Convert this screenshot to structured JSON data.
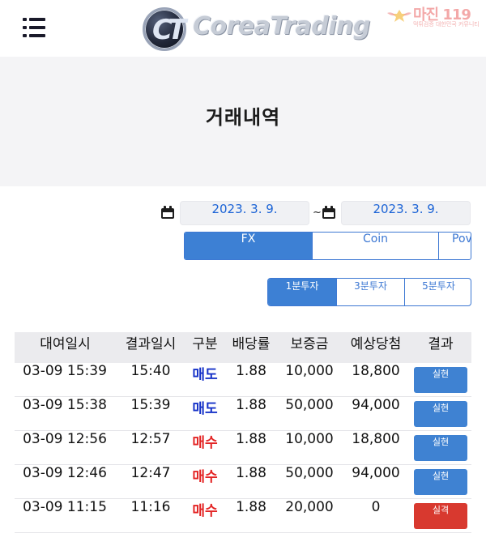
{
  "header": {
    "logo_text": "CoreaTrading",
    "logo_glyph": "CT",
    "watermark_title": "마진 119",
    "watermark_sub": "먹튀검증 대한민국 커뮤니티"
  },
  "page": {
    "title": "거래내역"
  },
  "filters": {
    "date_from": "2023. 3. 9.",
    "date_separator": "~",
    "date_to": "2023. 3. 9."
  },
  "market_tabs": [
    {
      "label": "FX",
      "active": true
    },
    {
      "label": "Coin",
      "active": false
    },
    {
      "label": "Pov",
      "active": false
    }
  ],
  "duration_tabs": [
    {
      "label": "1분투자",
      "active": true
    },
    {
      "label": "3분투자",
      "active": false
    },
    {
      "label": "5분투자",
      "active": false
    }
  ],
  "table": {
    "headers": [
      "대여일시",
      "결과일시",
      "구분",
      "배당률",
      "보증금",
      "예상당첨",
      "결과"
    ],
    "rows": [
      {
        "rent_time": "03-09 15:39",
        "result_time": "15:40",
        "type": "매도",
        "odds": "1.88",
        "deposit": "10,000",
        "expected": "18,800",
        "result": "실현"
      },
      {
        "rent_time": "03-09 15:38",
        "result_time": "15:39",
        "type": "매도",
        "odds": "1.88",
        "deposit": "50,000",
        "expected": "94,000",
        "result": "실현"
      },
      {
        "rent_time": "03-09 12:56",
        "result_time": "12:57",
        "type": "매수",
        "odds": "1.88",
        "deposit": "10,000",
        "expected": "18,800",
        "result": "실현"
      },
      {
        "rent_time": "03-09 12:46",
        "result_time": "12:47",
        "type": "매수",
        "odds": "1.88",
        "deposit": "50,000",
        "expected": "94,000",
        "result": "실현"
      },
      {
        "rent_time": "03-09 11:15",
        "result_time": "11:16",
        "type": "매수",
        "odds": "1.88",
        "deposit": "20,000",
        "expected": "0",
        "result": "실격"
      }
    ]
  },
  "colors": {
    "accent": "#3d80d4",
    "sell_text": "#1632c8",
    "buy_text": "#e32424",
    "success_button": "#3f82d2",
    "fail_button": "#d8392f",
    "date_text": "#1b63d6"
  }
}
